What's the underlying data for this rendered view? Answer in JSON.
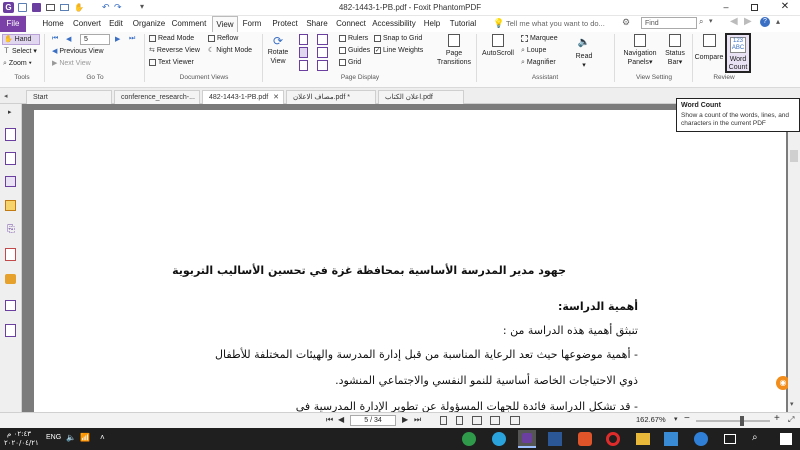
{
  "window": {
    "title": "482-1443-1-PB.pdf - Foxit PhantomPDF"
  },
  "menu": {
    "items": [
      "File",
      "Home",
      "Convert",
      "Edit",
      "Organize",
      "Comment",
      "View",
      "Form",
      "Protect",
      "Share",
      "Connect",
      "Accessibility",
      "Help",
      "Tutorial"
    ],
    "tell_me": "Tell me what you want to do...",
    "find": "Find"
  },
  "ribbon": {
    "tools": {
      "hand": "Hand",
      "select": "Select",
      "zoom": "Zoom",
      "label": "Tools"
    },
    "goto": {
      "page_value": "5",
      "previous_view": "Previous View",
      "next_view": "Next View",
      "label": "Go To"
    },
    "docviews": {
      "read_mode": "Read Mode",
      "reverse_view": "Reverse View",
      "text_viewer": "Text Viewer",
      "reflow": "Reflow",
      "night_mode": "Night Mode",
      "label": "Document Views"
    },
    "pagedisplay": {
      "rotate_view": "Rotate View",
      "rulers": "Rulers",
      "guides": "Guides",
      "grid": "Grid",
      "snap_to_grid": "Snap to Grid",
      "line_weights": "Line Weights",
      "page_transitions": "Page Transitions",
      "label": "Page Display"
    },
    "assistant": {
      "autoscroll": "AutoScroll",
      "marquee": "Marquee",
      "loupe": "Loupe",
      "magnifier": "Magnifier",
      "read": "Read",
      "label": "Assistant"
    },
    "viewsetting": {
      "navigation_panels": "Navigation Panels",
      "status_bar": "Status Bar",
      "label": "View Setting"
    },
    "review": {
      "compare": "Compare",
      "word_count": "Word Count",
      "word_count_icon": "123 ABC",
      "label": "Review"
    }
  },
  "tabs": [
    "Start",
    "conference_research-...",
    "482-1443-1-PB.pdf",
    "مصاف الاعلان.pdf *",
    "اعلان الكتاب.pdf"
  ],
  "tooltip": {
    "title": "Word Count",
    "body": "Show a count of the words, lines, and characters in the current PDF"
  },
  "document": {
    "heading": "جهود مدير المدرسة الأساسية بمحافظة غزة في تحسين الأساليب التربوية",
    "section_title": "أهمية الدراسة:",
    "line1": "تنبثق أهمية هذه الدراسة من :",
    "line2": "-  أهمية موضوعها حيث تعد الرعاية المناسبة من قبل إدارة المدرسة والهيئات المختلفة للأطفال",
    "line3": "ذوي الاحتياجات الخاصة أساسية للنمو النفسي والاجتماعي المنشود.",
    "line4": "- قد تشكل الدراسة فائدة للجهات المسؤولة عن تطوير الإدارة المدرسية في"
  },
  "status": {
    "page": "5 / 34",
    "zoom": "162.67%"
  },
  "taskbar": {
    "lang": "ENG",
    "time": "٠٢:٤٣ م",
    "date": "٢٠٢٠/٠٤/٢١"
  },
  "colors": {
    "accent": "#6b3fa0",
    "file_tab": "#7b3fa8",
    "ribbon_bg": "#fafafa",
    "doc_bg": "#7b7b7b",
    "taskbar": "#1f1f1f"
  }
}
